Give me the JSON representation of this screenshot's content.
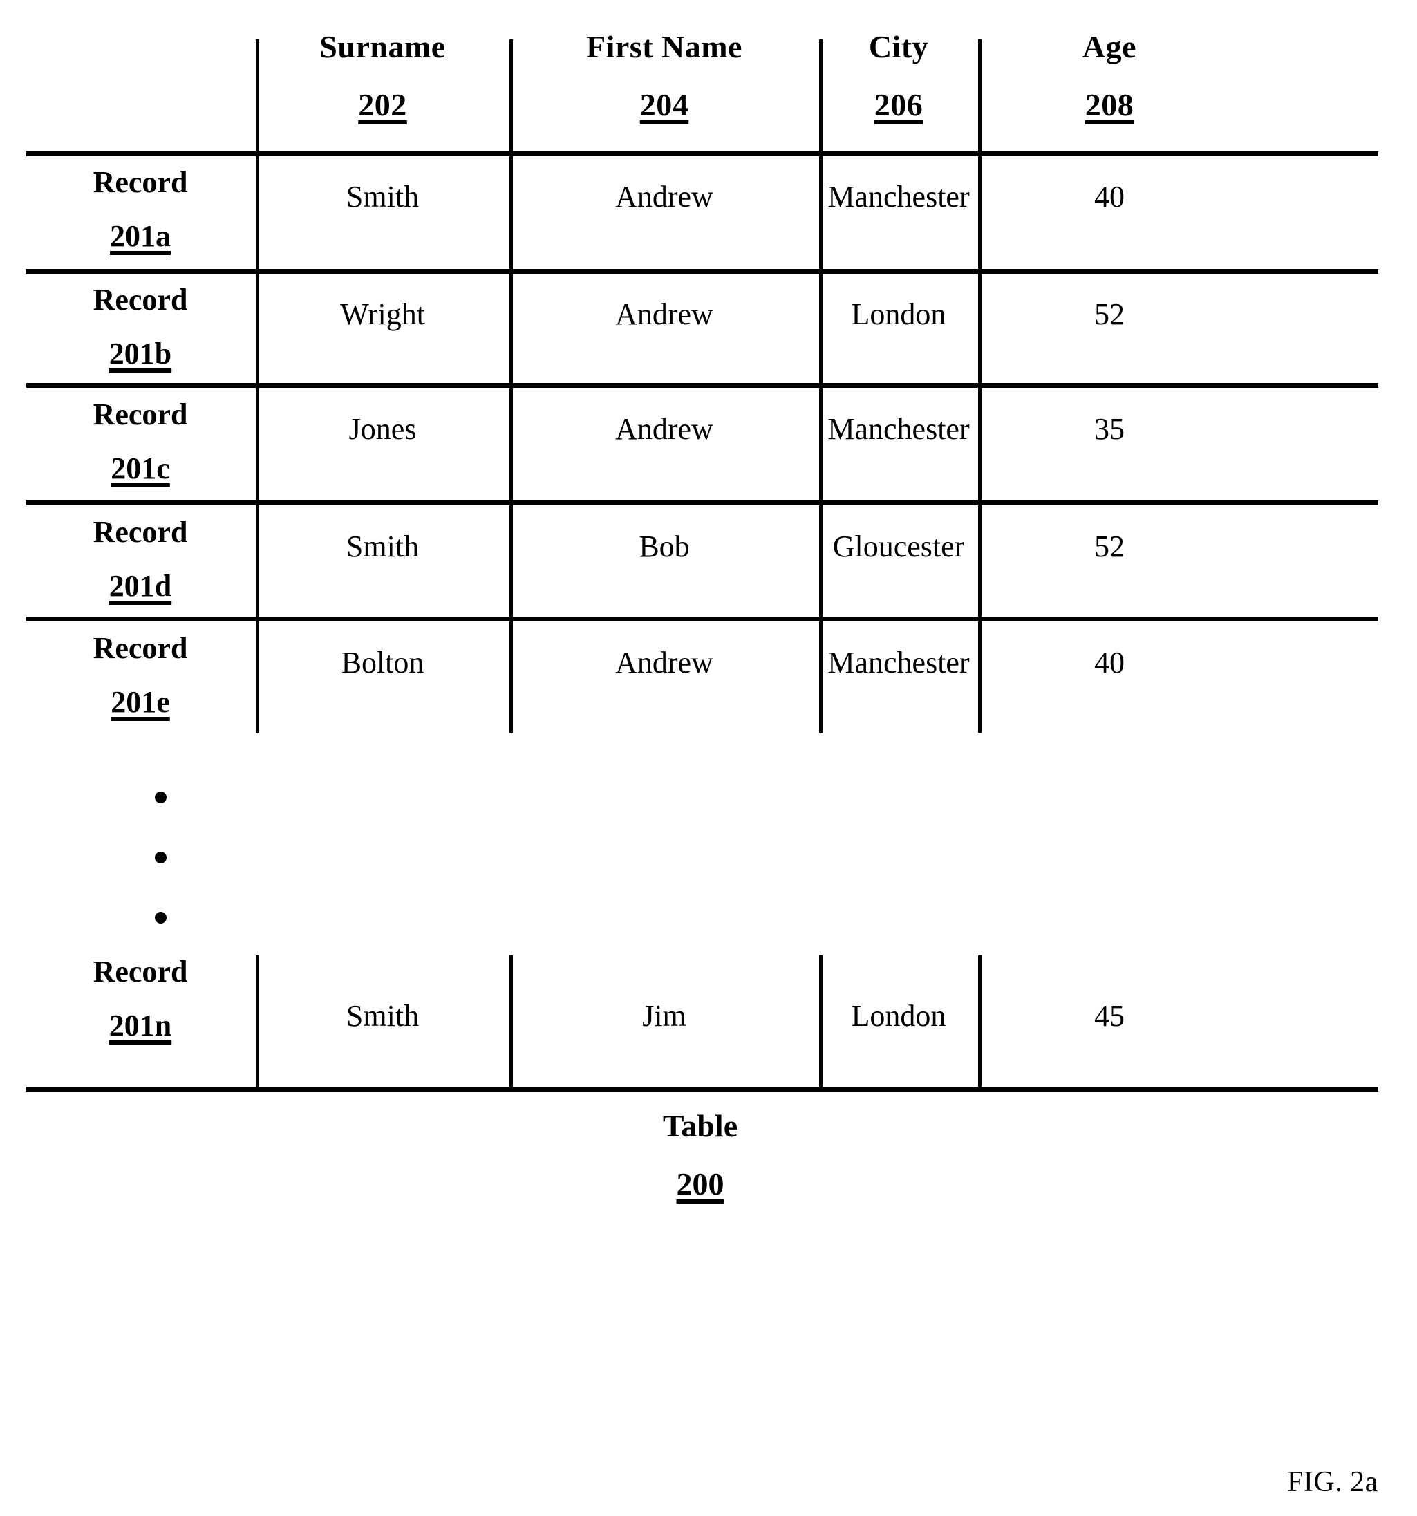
{
  "figure": {
    "label": "FIG. 2a"
  },
  "table": {
    "caption_word": "Table",
    "caption_number": "200",
    "stub_header": "",
    "columns": [
      {
        "title": "Surname",
        "number": "202"
      },
      {
        "title": "First Name",
        "number": "204"
      },
      {
        "title": "City",
        "number": "206"
      },
      {
        "title": "Age",
        "number": "208"
      }
    ],
    "row_label_word": "Record",
    "rows": [
      {
        "id": "201a",
        "surname": "Smith",
        "first_name": "Andrew",
        "city": "Manchester",
        "age": "40"
      },
      {
        "id": "201b",
        "surname": "Wright",
        "first_name": "Andrew",
        "city": "London",
        "age": "52"
      },
      {
        "id": "201c",
        "surname": "Jones",
        "first_name": "Andrew",
        "city": "Manchester",
        "age": "35"
      },
      {
        "id": "201d",
        "surname": "Smith",
        "first_name": "Bob",
        "city": "Gloucester",
        "age": "52"
      },
      {
        "id": "201e",
        "surname": "Bolton",
        "first_name": "Andrew",
        "city": "Manchester",
        "age": "40"
      },
      {
        "id": "201n",
        "surname": "Smith",
        "first_name": "Jim",
        "city": "London",
        "age": "45"
      }
    ],
    "continuation_marker": "vertical-ellipsis-three-dots"
  },
  "colors": {
    "ink": "#000000",
    "page": "#ffffff"
  }
}
